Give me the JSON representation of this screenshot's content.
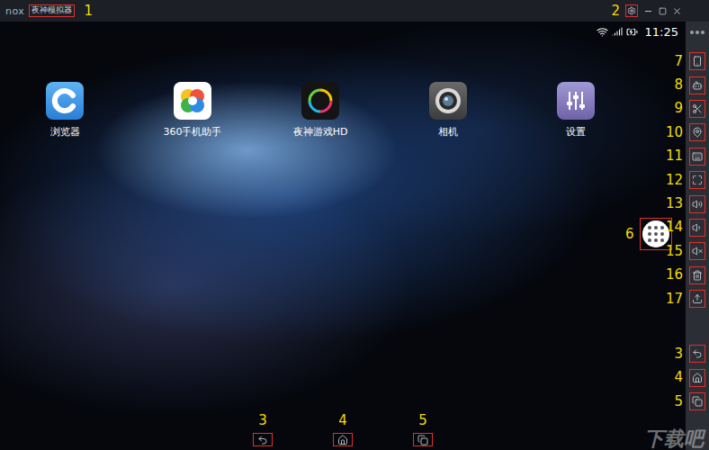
{
  "window": {
    "logo": "nox",
    "title": "夜神模拟器",
    "title_marker": "1",
    "settings_marker": "2"
  },
  "status_bar": {
    "time": "11:25"
  },
  "apps": [
    {
      "name": "浏览器",
      "kind": "browser"
    },
    {
      "name": "360手机助手",
      "kind": "app-store"
    },
    {
      "name": "夜神游戏HD",
      "kind": "game-center"
    },
    {
      "name": "相机",
      "kind": "camera"
    },
    {
      "name": "设置",
      "kind": "settings"
    }
  ],
  "floating_button": {
    "marker": "6"
  },
  "nav_buttons": [
    {
      "marker": "3",
      "kind": "back"
    },
    {
      "marker": "4",
      "kind": "home"
    },
    {
      "marker": "5",
      "kind": "recent"
    }
  ],
  "sidebar_tools": [
    {
      "marker": "7",
      "kind": "shake"
    },
    {
      "marker": "8",
      "kind": "robot"
    },
    {
      "marker": "9",
      "kind": "screenshot"
    },
    {
      "marker": "10",
      "kind": "location"
    },
    {
      "marker": "11",
      "kind": "keyboard"
    },
    {
      "marker": "12",
      "kind": "fullscreen"
    },
    {
      "marker": "13",
      "kind": "volume-up"
    },
    {
      "marker": "14",
      "kind": "volume-down"
    },
    {
      "marker": "15",
      "kind": "mute"
    },
    {
      "marker": "16",
      "kind": "clean"
    },
    {
      "marker": "17",
      "kind": "install-apk"
    }
  ],
  "sidebar_nav": [
    {
      "marker": "3",
      "kind": "back"
    },
    {
      "marker": "4",
      "kind": "home"
    },
    {
      "marker": "5",
      "kind": "recent"
    }
  ],
  "watermark": "下载吧"
}
